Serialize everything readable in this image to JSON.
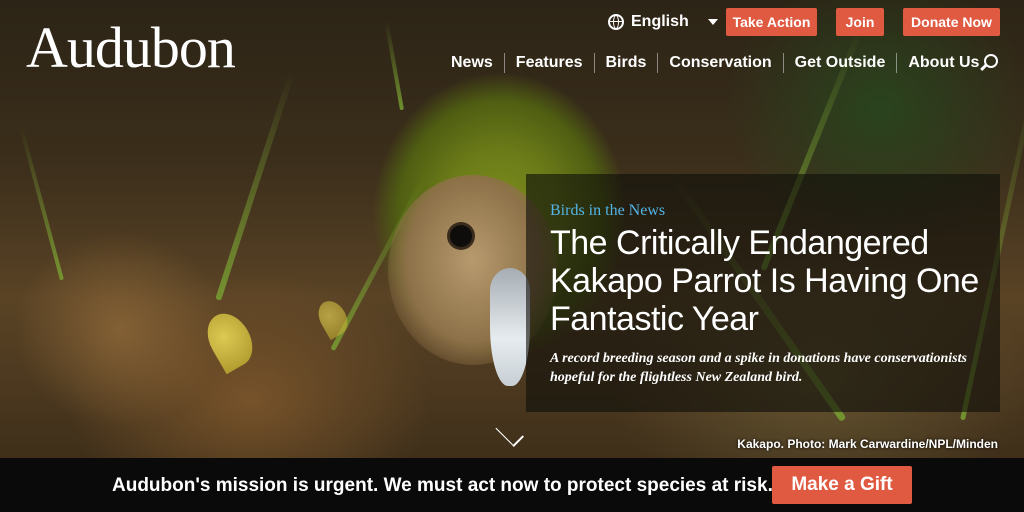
{
  "header": {
    "logo": "Audubon",
    "language": "English",
    "buttons": {
      "take_action": "Take Action",
      "join": "Join",
      "donate": "Donate Now"
    },
    "nav": [
      "News",
      "Features",
      "Birds",
      "Conservation",
      "Get Outside",
      "About Us"
    ]
  },
  "story": {
    "kicker": "Birds in the News",
    "headline": "The Critically Endangered Kakapo Parrot Is Having One Fantastic Year",
    "dek": "A record breeding season and a spike in donations have conservationists hopeful for the flightless New Zealand bird.",
    "photo_credit": "Kakapo. Photo: Mark Carwardine/NPL/Minden"
  },
  "banner": {
    "message": "Audubon's mission is urgent. We must act now to protect species at risk.",
    "button": "Make a Gift"
  },
  "colors": {
    "accent": "#e05a42",
    "kicker": "#52b5e5",
    "banner_bg": "#0a0a0a"
  },
  "icons": [
    "globe-icon",
    "caret-down-icon",
    "search-icon",
    "chevron-down-icon"
  ]
}
